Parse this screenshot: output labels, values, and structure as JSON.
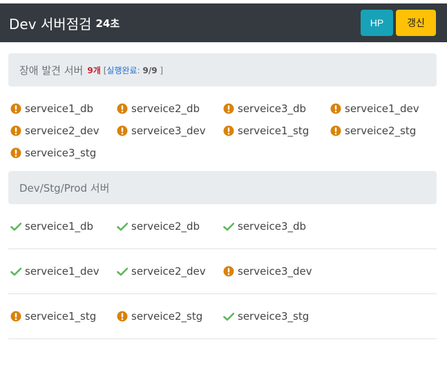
{
  "header": {
    "title": "Dev 서버점검",
    "seconds": "24초",
    "hp_label": "HP",
    "refresh_label": "갱신"
  },
  "issue_panel": {
    "title": "장애 발견 서버",
    "count": "9개",
    "bracket_open": "[",
    "status_label": "실행완료",
    "colon": ":",
    "ratio": "9/9",
    "bracket_close": "]",
    "servers": [
      {
        "name": "serveice1_db",
        "status": "warning"
      },
      {
        "name": "serveice2_db",
        "status": "warning"
      },
      {
        "name": "serveice3_db",
        "status": "warning"
      },
      {
        "name": "serveice1_dev",
        "status": "warning"
      },
      {
        "name": "serveice2_dev",
        "status": "warning"
      },
      {
        "name": "serveice3_dev",
        "status": "warning"
      },
      {
        "name": "serveice1_stg",
        "status": "warning"
      },
      {
        "name": "serveice2_stg",
        "status": "warning"
      },
      {
        "name": "serveice3_stg",
        "status": "warning"
      }
    ]
  },
  "env_panel": {
    "title": "Dev/Stg/Prod 서버",
    "rows": [
      [
        {
          "name": "serveice1_db",
          "status": "ok"
        },
        {
          "name": "serveice2_db",
          "status": "ok"
        },
        {
          "name": "serveice3_db",
          "status": "ok"
        }
      ],
      [
        {
          "name": "serveice1_dev",
          "status": "ok"
        },
        {
          "name": "serveice2_dev",
          "status": "ok"
        },
        {
          "name": "serveice3_dev",
          "status": "warning"
        }
      ],
      [
        {
          "name": "serveice1_stg",
          "status": "warning"
        },
        {
          "name": "serveice2_stg",
          "status": "warning"
        },
        {
          "name": "serveice3_stg",
          "status": "ok"
        }
      ]
    ]
  },
  "colors": {
    "warning": "#d9820b",
    "ok": "#5cb85c"
  }
}
